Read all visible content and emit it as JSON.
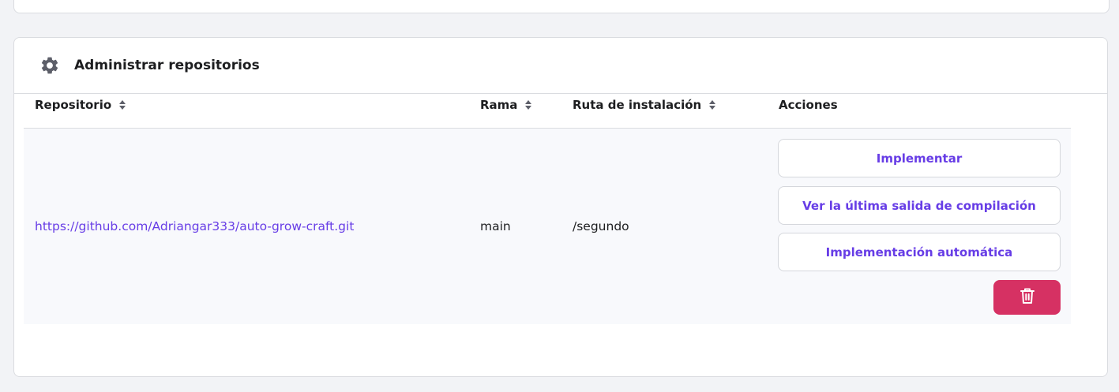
{
  "section": {
    "title": "Administrar repositorios",
    "icon": "gear-icon"
  },
  "table": {
    "columns": [
      {
        "label": "Repositorio",
        "sortable": true
      },
      {
        "label": "Rama",
        "sortable": true
      },
      {
        "label": "Ruta de instalación",
        "sortable": true
      },
      {
        "label": "Acciones",
        "sortable": false
      }
    ],
    "rows": [
      {
        "repository": "https://github.com/Adriangar333/auto-grow-craft.git",
        "branch": "main",
        "install_path": "/segundo",
        "actions": {
          "deploy": "Implementar",
          "view_build_output": "Ver la última salida de compilación",
          "auto_deploy": "Implementación automática",
          "delete_icon": "trash-icon"
        }
      }
    ]
  },
  "colors": {
    "accent": "#673de6",
    "danger": "#d63163",
    "background": "#f2f3f6",
    "row_background": "#f8f9fc"
  }
}
